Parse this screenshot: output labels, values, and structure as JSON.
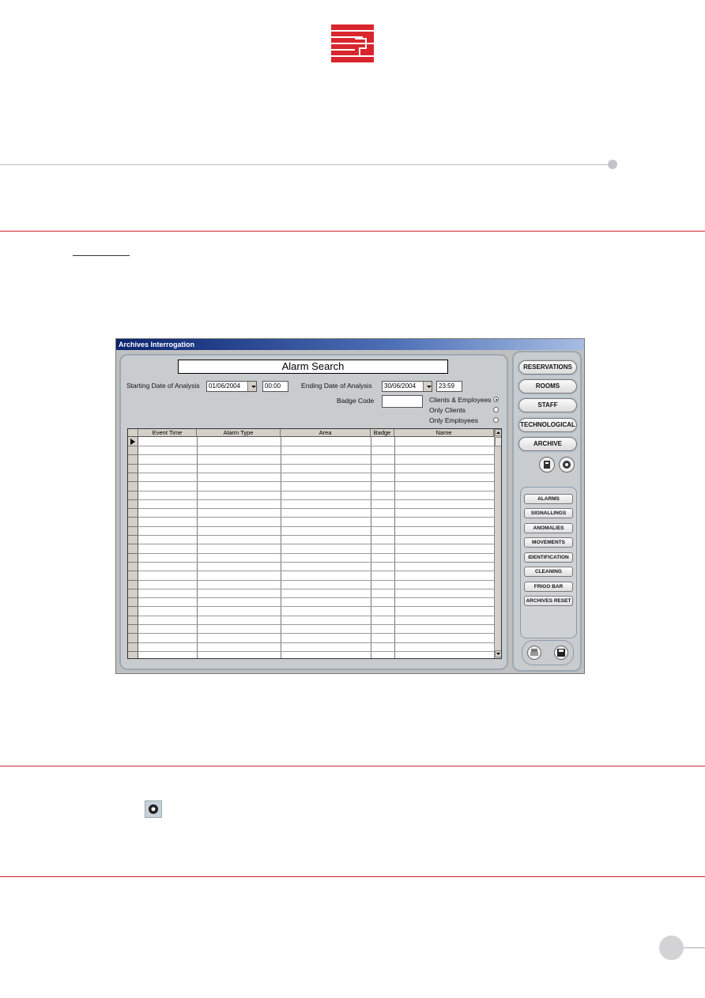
{
  "window": {
    "title": "Archives Interrogation"
  },
  "search": {
    "heading": "Alarm Search",
    "start_label": "Starting Date of Analysis",
    "start_date": "01/06/2004",
    "start_time": "00:00",
    "end_label": "Ending Date of Analysis",
    "end_date": "30/06/2004",
    "end_time": "23:59",
    "badge_label": "Badge Code",
    "badge_value": "",
    "filter_options": [
      {
        "label": "Clients & Employees",
        "selected": true
      },
      {
        "label": "Only Clients",
        "selected": false
      },
      {
        "label": "Only Employees",
        "selected": false
      }
    ]
  },
  "grid": {
    "columns": [
      "Event Time",
      "Alarm Type",
      "Area",
      "Badge",
      "Name"
    ]
  },
  "side_menu": {
    "main": [
      "RESERVATIONS",
      "ROOMS",
      "STAFF",
      "TECHNOLOGICAL",
      "ARCHIVE"
    ],
    "archive_types": [
      "ALARMS",
      "SIGNALLINGS",
      "ANOMALIES",
      "MOVEMENTS",
      "IDENTIFICATION",
      "CLEANING",
      "FRIGO BAR",
      "ARCHIVES RESET"
    ]
  },
  "icons": {
    "logo": "logo-icon",
    "view": "view-icon",
    "refresh": "refresh-icon",
    "print": "printer-icon",
    "save": "floppy-icon"
  },
  "colors": {
    "accent_red": "#c8202a",
    "titlebar": "#0a2470"
  }
}
